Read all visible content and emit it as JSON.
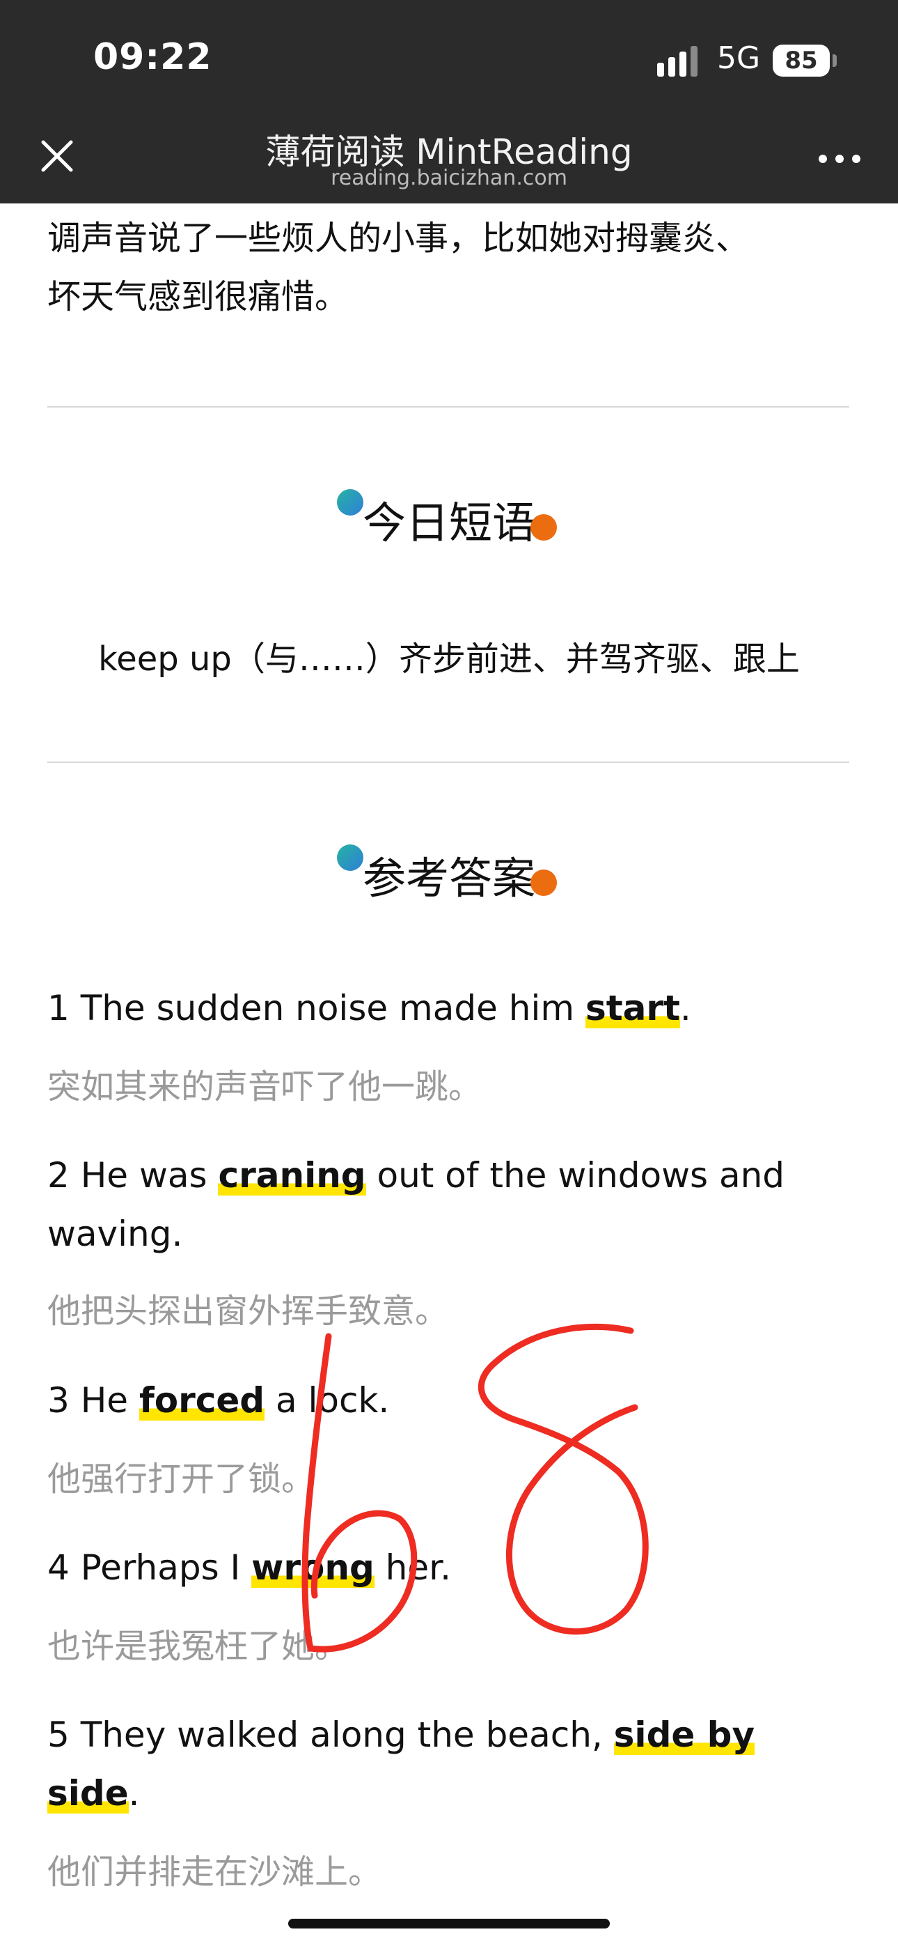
{
  "status_bar": {
    "time": "09:22",
    "network": "5G",
    "battery": "85"
  },
  "header": {
    "title": "薄荷阅读 MintReading",
    "url": "reading.baicizhan.com"
  },
  "content": {
    "intro_line1": "调声音说了一些烦人的小事，比如她对拇囊炎、",
    "intro_line2": "坏天气感到很痛惜。",
    "phrase_section": {
      "title": "今日短语",
      "phrase": "keep up（与……）齐步前进、并驾齐驱、跟上"
    },
    "answers_section": {
      "title": "参考答案",
      "items": [
        {
          "pre": "1 The sudden noise made him ",
          "keyword": "start",
          "post": ".",
          "translation": "突如其来的声音吓了他一跳。"
        },
        {
          "pre": "2 He was ",
          "keyword": "craning",
          "post": " out of the windows and",
          "line2": "waving.",
          "translation": "他把头探出窗外挥手致意。"
        },
        {
          "pre": "3 He ",
          "keyword": "forced",
          "post": " a lock.",
          "translation": "他强行打开了锁。"
        },
        {
          "pre": "4 Perhaps I ",
          "keyword": "wrong",
          "post": " her.",
          "translation": "也许是我冤枉了她。"
        },
        {
          "pre": "5 They walked along the beach, ",
          "keyword": "side by",
          "line2_keyword": "side",
          "line2_post": ".",
          "translation": "他们并排走在沙滩上。"
        }
      ]
    }
  },
  "annotation": {
    "handwritten": "68",
    "color": "#ee2c22"
  },
  "colors": {
    "topbar": "#2b2b2b",
    "highlight": "#ffe500",
    "translation_text": "#9a9a9a"
  }
}
